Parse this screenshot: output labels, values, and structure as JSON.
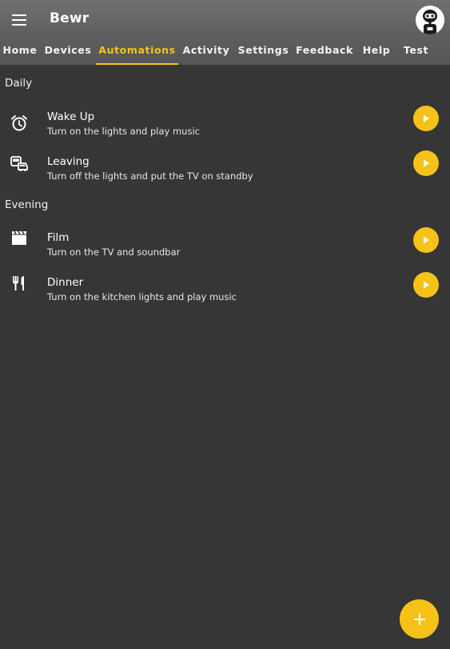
{
  "app": {
    "title": "Bewr"
  },
  "tabs": [
    {
      "label": "Home"
    },
    {
      "label": "Devices"
    },
    {
      "label": "Automations"
    },
    {
      "label": "Activity"
    },
    {
      "label": "Settings"
    },
    {
      "label": "Feedback"
    },
    {
      "label": "Help"
    },
    {
      "label": "Test"
    }
  ],
  "active_tab": "Automations",
  "sections": [
    {
      "header": "Daily",
      "items": [
        {
          "icon": "alarm-icon",
          "title": "Wake Up",
          "subtitle": "Turn on the lights and play music"
        },
        {
          "icon": "commute-icon",
          "title": "Leaving",
          "subtitle": "Turn off the lights and put the TV on standby"
        }
      ]
    },
    {
      "header": "Evening",
      "items": [
        {
          "icon": "movie-icon",
          "title": "Film",
          "subtitle": "Turn on the TV and soundbar"
        },
        {
          "icon": "restaurant-icon",
          "title": "Dinner",
          "subtitle": "Turn on the kitchen lights and play music"
        }
      ]
    }
  ],
  "colors": {
    "accent": "#f7c218",
    "background": "#363636",
    "appbar": "#626262",
    "text": "#ffffff"
  },
  "fab_icon": "plus-icon"
}
